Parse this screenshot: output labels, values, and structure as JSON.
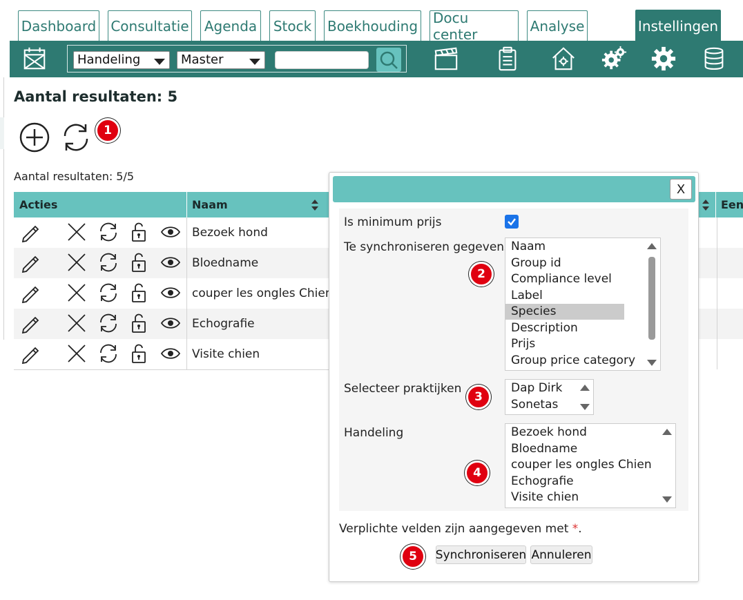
{
  "tabs": [
    {
      "label": "Dashboard"
    },
    {
      "label": "Consultatie"
    },
    {
      "label": "Agenda"
    },
    {
      "label": "Stock"
    },
    {
      "label": "Boekhouding"
    },
    {
      "label": "Docu center"
    },
    {
      "label": "Analyse"
    },
    {
      "label": "Instellingen"
    }
  ],
  "active_tab": "Instellingen",
  "toolbar": {
    "filter_type": "Handeling",
    "filter_scope": "Master",
    "search_value": "",
    "icons": [
      "calendar-x-icon",
      "search-icon",
      "clapperboard-icon",
      "clipboard-icon",
      "house-gear-icon",
      "gears-icon",
      "gear-icon",
      "database-icon"
    ]
  },
  "page": {
    "title": "Aantal resultaten: 5",
    "count_text": "Aantal resultaten: 5/5"
  },
  "table": {
    "headers": {
      "acties": "Acties",
      "naam": "Naam",
      "een": "Een"
    },
    "rows": [
      {
        "naam": "Bezoek hond"
      },
      {
        "naam": "Bloedname"
      },
      {
        "naam": "couper les ongles Chien"
      },
      {
        "naam": "Echografie"
      },
      {
        "naam": "Visite chien"
      }
    ],
    "row_icons": [
      "pencil-icon",
      "cross-icon",
      "sync-icon",
      "unlock-icon",
      "eye-icon"
    ]
  },
  "modal": {
    "close_label": "X",
    "fields": {
      "min_price_label": "Is minimum prijs",
      "min_price_checked": true,
      "sync_label": "Te synchroniseren gegevens",
      "sync_options": [
        "Naam",
        "Group id",
        "Compliance level",
        "Label",
        "Species",
        "Description",
        "Prijs",
        "Group price category"
      ],
      "sync_selected": "Species",
      "practices_label": "Selecteer praktijken",
      "practices_options": [
        "Dap Dirk",
        "Sonetas"
      ],
      "handeling_label": "Handeling",
      "handeling_options": [
        "Bezoek hond",
        "Bloedname",
        "couper les ongles Chien",
        "Echografie",
        "Visite chien"
      ]
    },
    "required_text": "Verplichte velden zijn aangegeven met ",
    "required_star": "*",
    "required_end": ".",
    "buttons": {
      "sync": "Synchroniseren",
      "cancel": "Annuleren"
    }
  },
  "badges": [
    "1",
    "2",
    "3",
    "4",
    "5"
  ],
  "colors": {
    "brand_dark": "#2e7a72",
    "brand_light": "#67c2be",
    "badge": "#e00010"
  }
}
